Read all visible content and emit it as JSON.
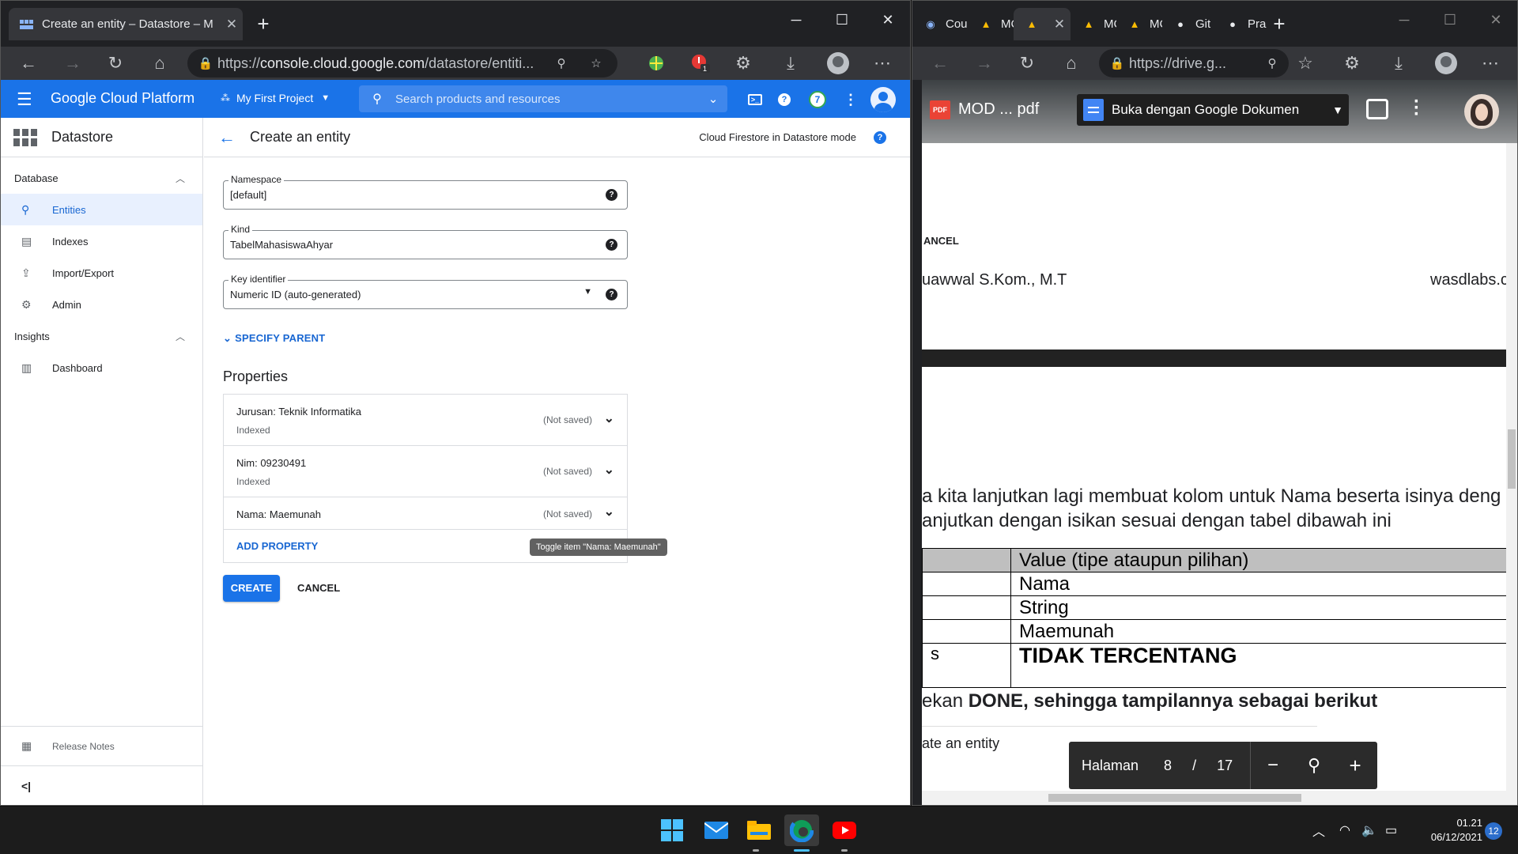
{
  "left_browser": {
    "tab_title": "Create an entity – Datastore – M",
    "url_prefix": "https://",
    "url_main": "console.cloud.google.com",
    "url_rest": "/datastore/entiti...",
    "ext_badge": "1"
  },
  "gcp": {
    "brand": "Google Cloud Platform",
    "project": "My First Project",
    "search_placeholder": "Search products and resources",
    "notif_count": "7",
    "sidebar_title": "Datastore",
    "section_database": "Database",
    "section_insights": "Insights",
    "nav": [
      "Entities",
      "Indexes",
      "Import/Export",
      "Admin"
    ],
    "nav_insights": [
      "Dashboard"
    ],
    "release_notes": "Release Notes",
    "collapse": "<|",
    "page_title": "Create an entity",
    "mode": "Cloud Firestore in Datastore mode",
    "namespace_label": "Namespace",
    "namespace_value": "[default]",
    "kind_label": "Kind",
    "kind_value": "TabelMahasiswaAhyar",
    "key_label": "Key identifier",
    "key_value": "Numeric ID (auto-generated)",
    "specify_parent": "SPECIFY PARENT",
    "properties_title": "Properties",
    "properties": [
      {
        "name": "Jurusan:  Teknik Informatika",
        "indexed": "Indexed",
        "status": "(Not saved)"
      },
      {
        "name": "Nim:  09230491",
        "indexed": "Indexed",
        "status": "(Not saved)"
      },
      {
        "name": "Nama:  Maemunah",
        "indexed": "",
        "status": "(Not saved)"
      }
    ],
    "add_property": "ADD PROPERTY",
    "tooltip": "Toggle item \"Nama:  Maemunah\"",
    "create": "CREATE",
    "cancel": "CANCEL"
  },
  "right_browser": {
    "tabs": [
      "Cou",
      "MC",
      "",
      "MC",
      "MC",
      "Git",
      "Pra"
    ],
    "url": "https://drive.g...",
    "pdf_badge": "PDF",
    "pdf_name": "MOD ... pdf",
    "open_with": "Buka dengan Google Dokumen",
    "doc_cancel": "ANCEL",
    "doc_author": "uawwal S.Kom., M.T",
    "doc_site": "wasdlabs.c",
    "doc_line1": "a kita lanjutkan lagi membuat kolom untuk Nama beserta isinya deng",
    "doc_line2": "anjutkan dengan isikan sesuai dengan tabel dibawah ini",
    "table_header": "Value (tipe ataupun pilihan)",
    "table_rows": [
      "Nama",
      "String",
      "Maemunah"
    ],
    "table_big_left": "s",
    "table_big": "TIDAK TERCENTANG",
    "doc_line3_pre": "ekan ",
    "doc_line3_bold": "DONE",
    "doc_line3_post": ", sehingga tampilannya sebagai berikut",
    "doc_line4": "ate an entity",
    "page_label": "Halaman",
    "page_current": "8",
    "page_sep": "/",
    "page_total": "17"
  },
  "taskbar": {
    "time": "01.21",
    "date": "06/12/2021",
    "notifications": "12"
  },
  "colors": {
    "gcp_blue": "#1a73e8",
    "pdf_red": "#ea4335"
  }
}
